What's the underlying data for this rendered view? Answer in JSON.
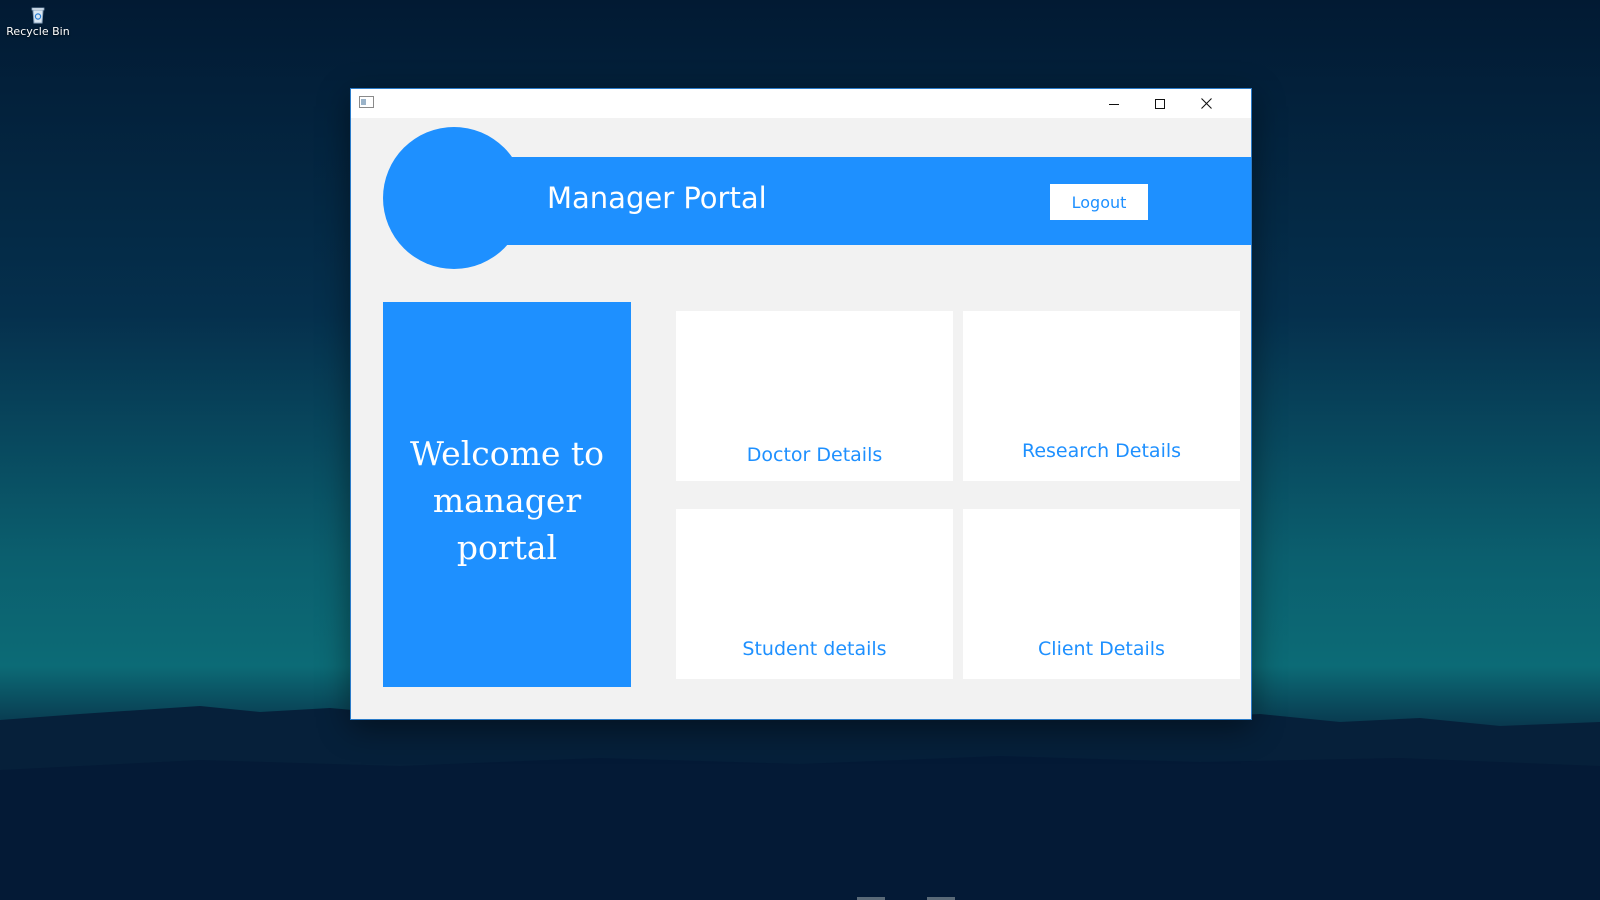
{
  "desktop": {
    "icons": [
      {
        "label": "Recycle Bin",
        "icon": "recycle-bin-icon"
      }
    ]
  },
  "window": {
    "app_icon": "window-app-icon",
    "caption_buttons": [
      "minimize-icon",
      "maximize-icon",
      "close-icon"
    ],
    "header": {
      "title": "Manager Portal",
      "logout_label": "Logout"
    },
    "welcome": {
      "line1": "Welcome to",
      "line2": "manager portal"
    },
    "cards": [
      {
        "label": "Doctor Details"
      },
      {
        "label": "Research Details"
      },
      {
        "label": "Student details"
      },
      {
        "label": "Client Details"
      }
    ]
  },
  "colors": {
    "accent": "#1e90ff",
    "window_background": "#f2f2f2",
    "card_background": "#ffffff"
  }
}
